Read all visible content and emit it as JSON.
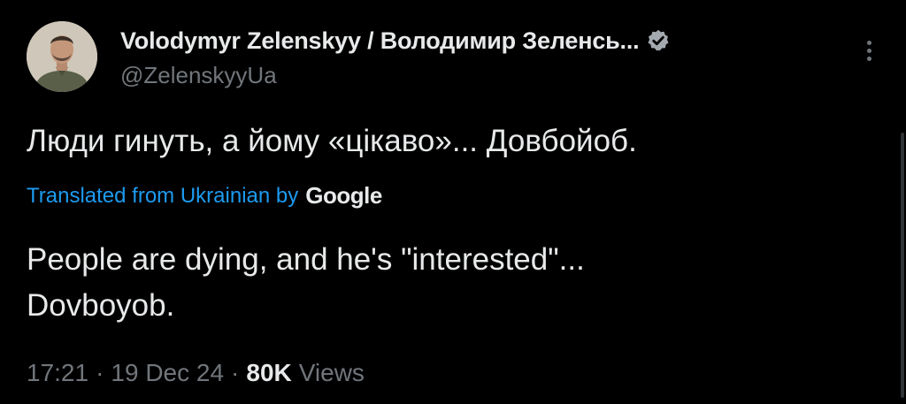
{
  "author": {
    "display_name": "Volodymyr Zelenskyy / Володимир Зеленсь...",
    "handle": "@ZelenskyyUa",
    "verified_icon": "verified-badge-icon",
    "avatar_icon": "avatar"
  },
  "tweet": {
    "original_text": "Люди гинуть, а йому «цікаво»... Довбойоб.",
    "translated_from_label": "Translated from Ukrainian by",
    "translation_provider": "Google",
    "translation_line1": "People are dying, and he's \"interested\"...",
    "translation_line2": "Dovboyob."
  },
  "meta": {
    "time": "17:21",
    "separator": "·",
    "date": "19 Dec 24",
    "views_count": "80K",
    "views_label": "Views"
  },
  "colors": {
    "background": "#000000",
    "text": "#e7e9ea",
    "muted": "#71767b",
    "link": "#1d9bf0",
    "verified": "#a3a9ae"
  },
  "icons": {
    "more": "more-vertical-icon"
  }
}
